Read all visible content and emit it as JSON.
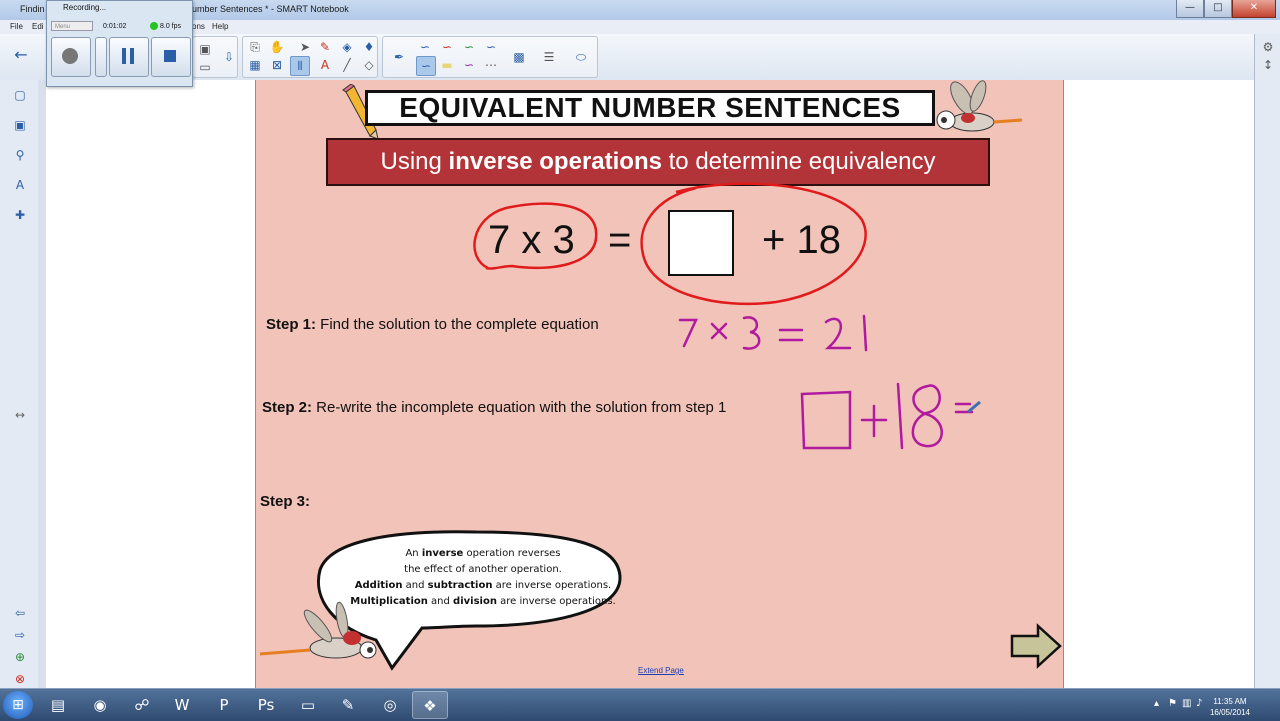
{
  "window": {
    "title": "Finding ... Number Sentences * - SMART Notebook",
    "title_left": "Findin",
    "title_right": "umber Sentences * - SMART Notebook",
    "controls": {
      "minimize": "—",
      "maximize": "□",
      "close": "✕"
    }
  },
  "menu": {
    "file": "File",
    "edit": "Edi",
    "options": "ons",
    "help": "Help"
  },
  "recorder": {
    "title": "Recording...",
    "time": "0:01:02",
    "fps": "8.0 fps",
    "menu_label": "Menu"
  },
  "toolbar": {
    "back": "←",
    "icons": [
      "pointer-icon",
      "pen-icon",
      "eraser-icon",
      "line-icon",
      "text-icon",
      "table-icon",
      "color-icon",
      "properties-icon",
      "fill-icon"
    ]
  },
  "page": {
    "title": "EQUIVALENT NUMBER SENTENCES",
    "subtitle_pre": "Using ",
    "subtitle_bold": "inverse operations",
    "subtitle_post": " to determine equivalency",
    "equation_left": "7 x 3",
    "equals": "=",
    "plus": "+ 18",
    "step1_label": "Step 1:",
    "step1_text": " Find the solution to the complete equation",
    "step2_label": "Step 2:",
    "step2_text": " Re-write the incomplete equation with the solution from step 1",
    "step3_label": "Step 3:",
    "ink_step1": "7 × 3 = 21",
    "ink_step2": "□+18=",
    "bubble_l1_pre": "An ",
    "bubble_l1_bold": "inverse",
    "bubble_l1_post": " operation reverses",
    "bubble_l2": "the effect of another operation.",
    "bubble_l3_bold1": "Addition",
    "bubble_l3_mid": " and ",
    "bubble_l3_bold2": "subtraction",
    "bubble_l3_post": " are inverse operations.",
    "bubble_l4_bold1": "Multiplication",
    "bubble_l4_mid": " and ",
    "bubble_l4_bold2": "division",
    "bubble_l4_post": " are inverse operations.",
    "extend_link": "Extend Page"
  },
  "colors": {
    "page_bg": "#f2c3b9",
    "banner": "#b33438",
    "ink_red": "#e01b1b",
    "ink_purple": "#b01a9e"
  },
  "taskbar": {
    "clock_time": "11:35 AM",
    "clock_date": "16/05/2014",
    "apps": [
      "start-orb",
      "explorer-icon",
      "media-icon",
      "network-icon",
      "word-icon",
      "powerpoint-icon",
      "photoshop-icon",
      "notepad-icon",
      "journal-icon",
      "chrome-icon",
      "smart-notebook-icon"
    ]
  }
}
